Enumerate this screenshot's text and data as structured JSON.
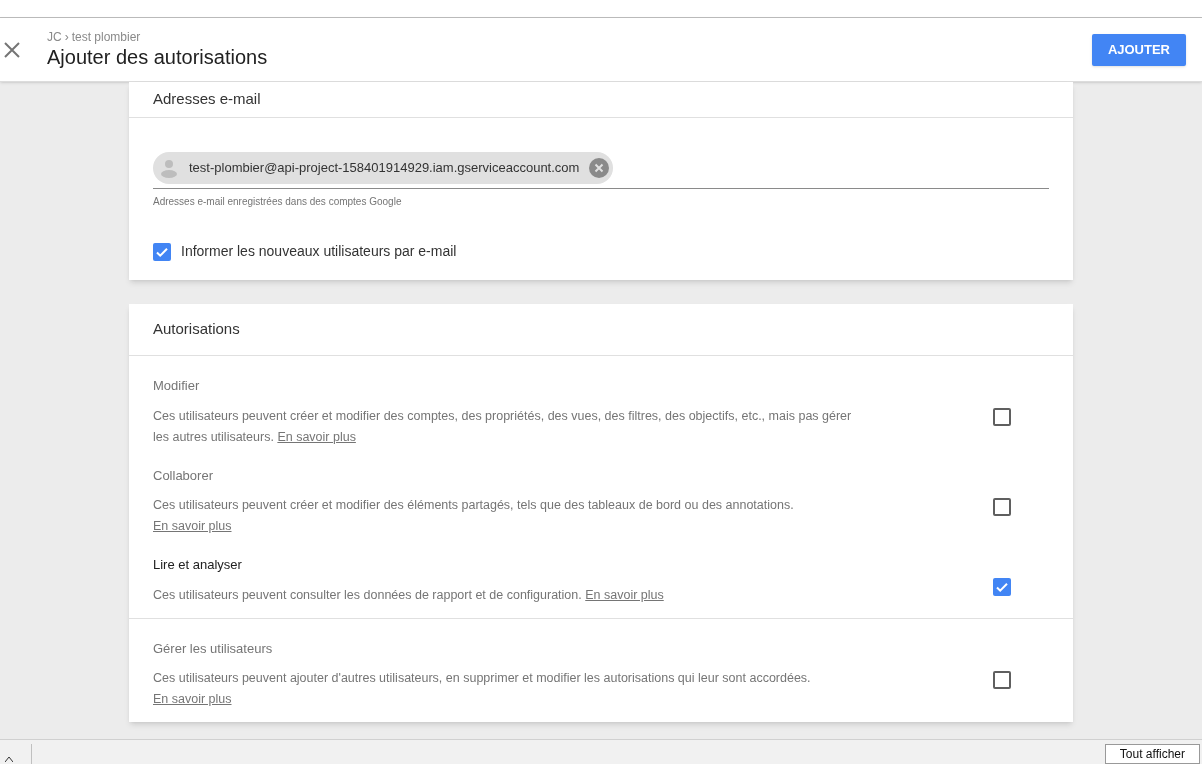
{
  "header": {
    "breadcrumb": [
      "JC",
      "test plombier"
    ],
    "breadcrumb_separator": "›",
    "title": "Ajouter des autorisations",
    "add_button": "AJOUTER"
  },
  "email_card": {
    "title": "Adresses e-mail",
    "chips": [
      {
        "email": "test-plombier@api-project-158401914929.iam.gserviceaccount.com"
      }
    ],
    "hint": "Adresses e-mail enregistrées dans des comptes Google",
    "notify": {
      "label": "Informer les nouveaux utilisateurs par e-mail",
      "checked": true
    }
  },
  "permissions_card": {
    "title": "Autorisations",
    "groups": [
      [
        {
          "title": "Modifier",
          "description": "Ces utilisateurs peuvent créer et modifier des comptes, des propriétés, des vues, des filtres, des objectifs, etc., mais pas gérer les autres utilisateurs.",
          "link": "En savoir plus",
          "checked": false
        },
        {
          "title": "Collaborer",
          "description": "Ces utilisateurs peuvent créer et modifier des éléments partagés, tels que des tableaux de bord ou des annotations.",
          "link": "En savoir plus",
          "checked": false
        },
        {
          "title": "Lire et analyser",
          "description": "Ces utilisateurs peuvent consulter les données de rapport et de configuration.",
          "link": "En savoir plus",
          "checked": true
        }
      ],
      [
        {
          "title": "Gérer les utilisateurs",
          "description": "Ces utilisateurs peuvent ajouter d'autres utilisateurs, en supprimer et modifier les autorisations qui leur sont accordées.",
          "link": "En savoir plus",
          "checked": false
        }
      ]
    ]
  },
  "bottom_bar": {
    "show_all_button": "Tout afficher"
  }
}
